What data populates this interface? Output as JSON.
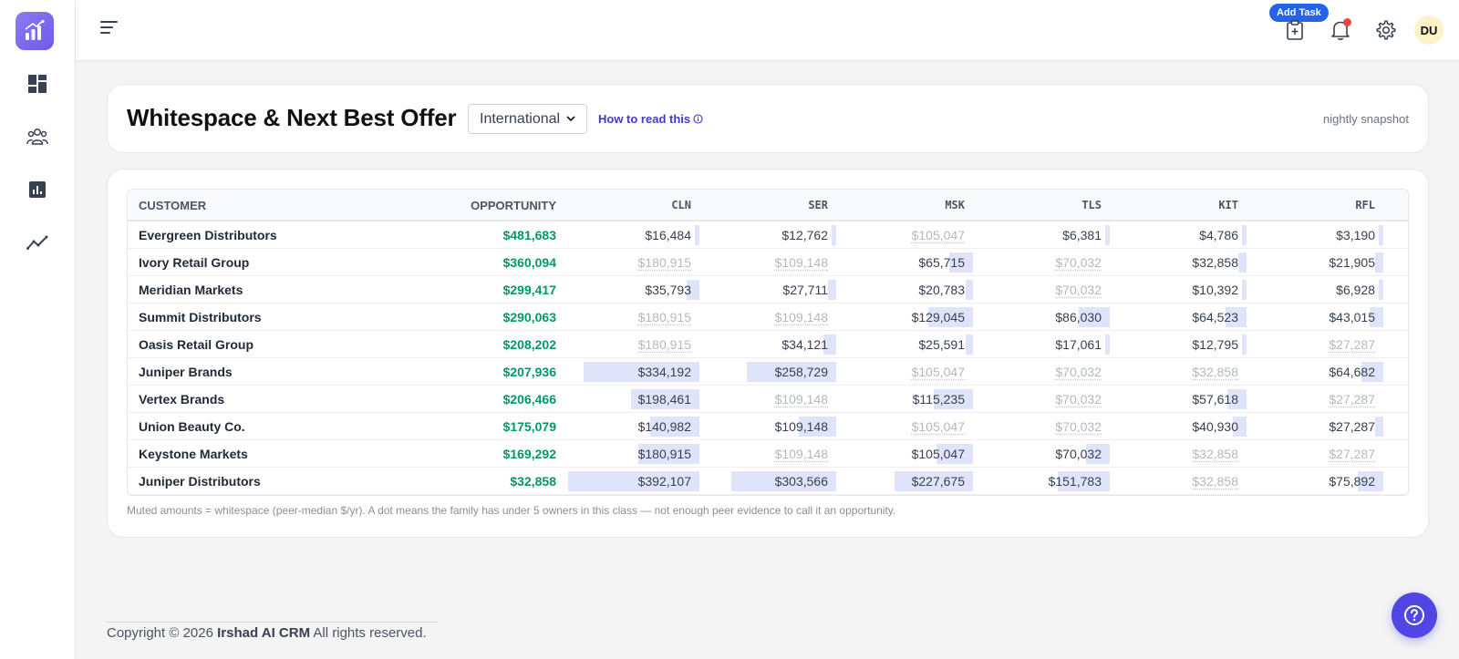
{
  "topbar": {
    "add_task_label": "Add Task",
    "avatar_initials": "DU"
  },
  "page": {
    "title": "Whitespace & Next Best Offer",
    "region": "International",
    "how_to_read": "How to read this",
    "snapshot_label": "nightly snapshot"
  },
  "table": {
    "headers": {
      "customer": "CUSTOMER",
      "opportunity": "OPPORTUNITY",
      "families": [
        "CLN",
        "SER",
        "MSK",
        "TLS",
        "KIT",
        "RFL"
      ]
    },
    "rows": [
      {
        "customer": "Evergreen Distributors",
        "opportunity": "$481,683",
        "cells": [
          {
            "text": "$16,484",
            "muted": false,
            "level": 0.03
          },
          {
            "text": "$12,762",
            "muted": false,
            "level": 0.03
          },
          {
            "text": "$105,047",
            "muted": true,
            "level": 0
          },
          {
            "text": "$6,381",
            "muted": false,
            "level": 0.03
          },
          {
            "text": "$4,786",
            "muted": false,
            "level": 0.03
          },
          {
            "text": "$3,190",
            "muted": false,
            "level": 0.03
          }
        ]
      },
      {
        "customer": "Ivory Retail Group",
        "opportunity": "$360,094",
        "cells": [
          {
            "text": "$180,915",
            "muted": true,
            "level": 0
          },
          {
            "text": "$109,148",
            "muted": true,
            "level": 0
          },
          {
            "text": "$65,715",
            "muted": false,
            "level": 0.17
          },
          {
            "text": "$70,032",
            "muted": true,
            "level": 0
          },
          {
            "text": "$32,858",
            "muted": false,
            "level": 0.06
          },
          {
            "text": "$21,905",
            "muted": false,
            "level": 0.06
          }
        ]
      },
      {
        "customer": "Meridian Markets",
        "opportunity": "$299,417",
        "cells": [
          {
            "text": "$35,793",
            "muted": false,
            "level": 0.09
          },
          {
            "text": "$27,711",
            "muted": false,
            "level": 0.06
          },
          {
            "text": "$20,783",
            "muted": false,
            "level": 0.05
          },
          {
            "text": "$70,032",
            "muted": true,
            "level": 0
          },
          {
            "text": "$10,392",
            "muted": false,
            "level": 0.03
          },
          {
            "text": "$6,928",
            "muted": false,
            "level": 0.03
          }
        ]
      },
      {
        "customer": "Summit Distributors",
        "opportunity": "$290,063",
        "cells": [
          {
            "text": "$180,915",
            "muted": true,
            "level": 0
          },
          {
            "text": "$109,148",
            "muted": true,
            "level": 0
          },
          {
            "text": "$129,045",
            "muted": false,
            "level": 0.32
          },
          {
            "text": "$86,030",
            "muted": false,
            "level": 0.22
          },
          {
            "text": "$64,523",
            "muted": false,
            "level": 0.15
          },
          {
            "text": "$43,015",
            "muted": false,
            "level": 0.1
          }
        ]
      },
      {
        "customer": "Oasis Retail Group",
        "opportunity": "$208,202",
        "cells": [
          {
            "text": "$180,915",
            "muted": true,
            "level": 0
          },
          {
            "text": "$34,121",
            "muted": false,
            "level": 0.09
          },
          {
            "text": "$25,591",
            "muted": false,
            "level": 0.05
          },
          {
            "text": "$17,061",
            "muted": false,
            "level": 0.03
          },
          {
            "text": "$12,795",
            "muted": false,
            "level": 0.03
          },
          {
            "text": "$27,287",
            "muted": true,
            "level": 0
          }
        ]
      },
      {
        "customer": "Juniper Brands",
        "opportunity": "$207,936",
        "cells": [
          {
            "text": "$334,192",
            "muted": false,
            "level": 0.83
          },
          {
            "text": "$258,729",
            "muted": false,
            "level": 0.64
          },
          {
            "text": "$105,047",
            "muted": true,
            "level": 0
          },
          {
            "text": "$70,032",
            "muted": true,
            "level": 0
          },
          {
            "text": "$32,858",
            "muted": true,
            "level": 0
          },
          {
            "text": "$64,682",
            "muted": false,
            "level": 0.16
          }
        ]
      },
      {
        "customer": "Vertex Brands",
        "opportunity": "$206,466",
        "cells": [
          {
            "text": "$198,461",
            "muted": false,
            "level": 0.49
          },
          {
            "text": "$109,148",
            "muted": true,
            "level": 0
          },
          {
            "text": "$115,235",
            "muted": false,
            "level": 0.28
          },
          {
            "text": "$70,032",
            "muted": true,
            "level": 0
          },
          {
            "text": "$57,618",
            "muted": false,
            "level": 0.14
          },
          {
            "text": "$27,287",
            "muted": true,
            "level": 0
          }
        ]
      },
      {
        "customer": "Union Beauty Co.",
        "opportunity": "$175,079",
        "cells": [
          {
            "text": "$140,982",
            "muted": false,
            "level": 0.35
          },
          {
            "text": "$109,148",
            "muted": false,
            "level": 0.27
          },
          {
            "text": "$105,047",
            "muted": true,
            "level": 0
          },
          {
            "text": "$70,032",
            "muted": true,
            "level": 0
          },
          {
            "text": "$40,930",
            "muted": false,
            "level": 0.1
          },
          {
            "text": "$27,287",
            "muted": false,
            "level": 0.06
          }
        ]
      },
      {
        "customer": "Keystone Markets",
        "opportunity": "$169,292",
        "cells": [
          {
            "text": "$180,915",
            "muted": false,
            "level": 0.44
          },
          {
            "text": "$109,148",
            "muted": true,
            "level": 0
          },
          {
            "text": "$105,047",
            "muted": false,
            "level": 0.26
          },
          {
            "text": "$70,032",
            "muted": false,
            "level": 0.17
          },
          {
            "text": "$32,858",
            "muted": true,
            "level": 0
          },
          {
            "text": "$27,287",
            "muted": true,
            "level": 0
          }
        ]
      },
      {
        "customer": "Juniper Distributors",
        "opportunity": "$32,858",
        "cells": [
          {
            "text": "$392,107",
            "muted": false,
            "level": 0.94
          },
          {
            "text": "$303,566",
            "muted": false,
            "level": 0.75
          },
          {
            "text": "$227,675",
            "muted": false,
            "level": 0.56
          },
          {
            "text": "$151,783",
            "muted": false,
            "level": 0.37
          },
          {
            "text": "$32,858",
            "muted": true,
            "level": 0
          },
          {
            "text": "$75,892",
            "muted": false,
            "level": 0.18
          }
        ]
      }
    ]
  },
  "footnote": "Muted amounts = whitespace (peer-median $/yr). A dot means the family has under 5 owners in this class — not enough peer evidence to call it an opportunity.",
  "footer": {
    "prefix": "Copyright © 2026 ",
    "brand": "Irshad AI CRM",
    "suffix": " All rights reserved."
  },
  "colors": {
    "accent": "#4f46e5",
    "opportunity_green": "#059669",
    "bar_fill": "#e0e4fb",
    "muted_text": "#b4b8c0"
  },
  "icons": {
    "sidebar": [
      "dashboard-icon",
      "people-icon",
      "report-icon",
      "trend-icon"
    ],
    "topbar": [
      "menu-icon",
      "add-task-icon",
      "bell-icon",
      "gear-icon"
    ],
    "help": "question-icon"
  }
}
